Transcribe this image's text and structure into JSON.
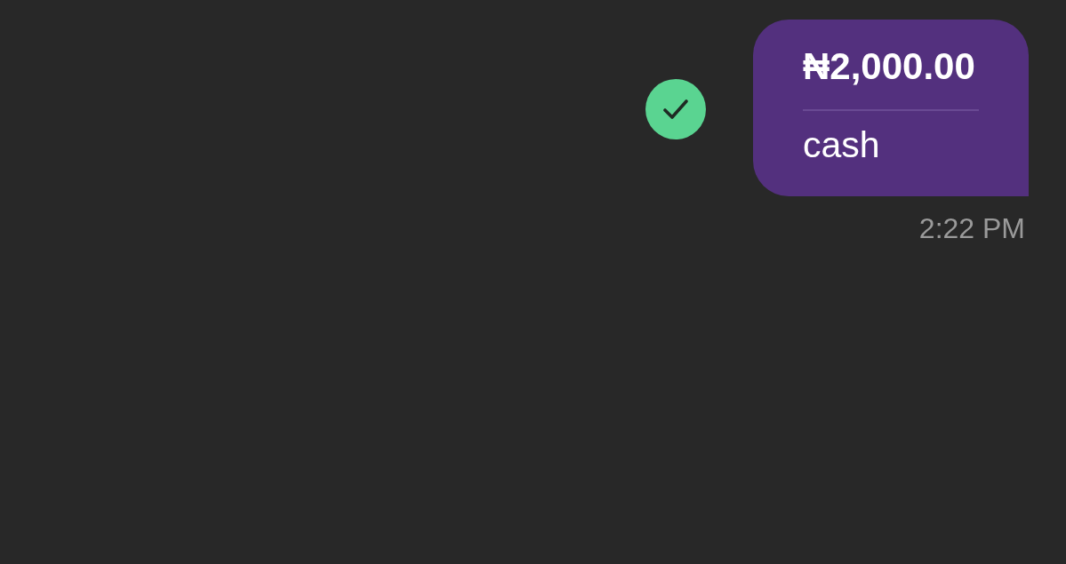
{
  "message": {
    "confirmed": true,
    "amount": "₦2,000.00",
    "note": "cash",
    "time": "2:22 PM"
  }
}
